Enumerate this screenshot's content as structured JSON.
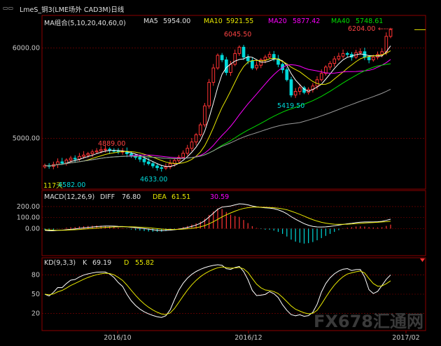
{
  "window": {
    "title": "LmeS_铜3(LME场外 CAD3M)日线",
    "corner_icon": "panel-toggle-icon"
  },
  "watermark": "FX678汇通网",
  "colors": {
    "bg": "#000000",
    "grid": "#8b0000",
    "axis_text": "#c8c8c8",
    "up": "#ff3333",
    "down": "#00d8d8",
    "ma5": "#ffffff",
    "ma10": "#e8e800",
    "ma20": "#ff00ff",
    "ma40": "#00dd00",
    "ma60": "#9a9a9a",
    "diff": "#ffffff",
    "dea": "#e8e800",
    "k": "#ffffff",
    "d": "#e8e800",
    "hi_label": "#ff4444",
    "lo_label": "#00d8d8"
  },
  "main_panel": {
    "ma_label": "MA组合(5,10,20,40,60,0)",
    "ma5_label": "MA5",
    "ma5_value": "5954.00",
    "ma10_label": "MA10",
    "ma10_value": "5921.55",
    "ma20_label": "MA20",
    "ma20_value": "5877.42",
    "ma40_label": "MA40",
    "ma40_value": "5748.61",
    "y_ticks": [
      "6000.00",
      "5000.00"
    ],
    "annotations": {
      "last_high": "6204.00",
      "peak": "6045.50",
      "pullback_low": "5419.50",
      "oct_high": "4889.00",
      "oct_low": "4633.00",
      "start_low": "4582.00",
      "start_marker": "117天"
    }
  },
  "macd_panel": {
    "label": "MACD(12,26,9)",
    "diff_label": "DIFF",
    "diff_value": "76.80",
    "dea_label": "DEA",
    "dea_value": "61.51",
    "macd_value": "30.59",
    "y_ticks": [
      "200.00",
      "100.00",
      "0.00"
    ]
  },
  "kd_panel": {
    "label": "KD(9,3,3)",
    "k_label": "K",
    "k_value": "69.19",
    "d_label": "D",
    "d_value": "55.82",
    "y_ticks": [
      "80",
      "50",
      "20"
    ]
  },
  "x_axis": {
    "ticks": [
      "2016/10",
      "2016/12",
      "2017/02"
    ]
  },
  "chart_data": {
    "type": "candlestick",
    "price_ylim": [
      4500,
      6300
    ],
    "close": [
      4700,
      4690,
      4710,
      4740,
      4725,
      4760,
      4780,
      4770,
      4800,
      4815,
      4830,
      4850,
      4860,
      4875,
      4880,
      4865,
      4860,
      4850,
      4855,
      4830,
      4805,
      4790,
      4770,
      4740,
      4720,
      4695,
      4675,
      4670,
      4685,
      4720,
      4755,
      4790,
      4835,
      4890,
      4960,
      5040,
      5150,
      5360,
      5620,
      5780,
      5920,
      5870,
      5730,
      5820,
      5940,
      6010,
      5900,
      5860,
      5780,
      5810,
      5870,
      5900,
      5930,
      5880,
      5820,
      5760,
      5650,
      5480,
      5520,
      5560,
      5510,
      5540,
      5580,
      5650,
      5720,
      5790,
      5830,
      5880,
      5910,
      5940,
      5930,
      5900,
      5950,
      5960,
      5900,
      5870,
      5900,
      5930,
      5960,
      6130,
      6204
    ],
    "macd_ylim": [
      -220,
      320
    ],
    "diff": [
      -15,
      -20,
      -20,
      -16,
      -14,
      -10,
      -6,
      -3,
      2,
      6,
      10,
      14,
      18,
      21,
      23,
      23,
      22,
      20,
      19,
      16,
      12,
      8,
      4,
      0,
      -5,
      -10,
      -15,
      -18,
      -17,
      -14,
      -10,
      -5,
      2,
      10,
      20,
      32,
      48,
      72,
      105,
      140,
      175,
      195,
      200,
      205,
      215,
      225,
      222,
      215,
      205,
      198,
      192,
      188,
      186,
      180,
      170,
      155,
      135,
      108,
      85,
      65,
      45,
      30,
      20,
      15,
      14,
      16,
      20,
      25,
      32,
      38,
      44,
      48,
      54,
      58,
      60,
      60,
      60,
      62,
      66,
      75,
      85
    ],
    "dea": [
      -10,
      -12,
      -14,
      -15,
      -15,
      -14,
      -12,
      -10,
      -8,
      -5,
      -2,
      1,
      4,
      8,
      11,
      13,
      15,
      16,
      17,
      17,
      16,
      15,
      13,
      11,
      8,
      4,
      0,
      -4,
      -6,
      -8,
      -8,
      -7,
      -5,
      -2,
      2,
      8,
      16,
      27,
      43,
      62,
      84,
      106,
      125,
      142,
      158,
      172,
      183,
      190,
      194,
      195,
      194,
      193,
      191,
      189,
      185,
      179,
      171,
      158,
      144,
      129,
      113,
      96,
      81,
      68,
      57,
      49,
      44,
      40,
      39,
      39,
      40,
      42,
      45,
      48,
      51,
      53,
      55,
      57,
      60,
      63,
      67
    ]
  }
}
